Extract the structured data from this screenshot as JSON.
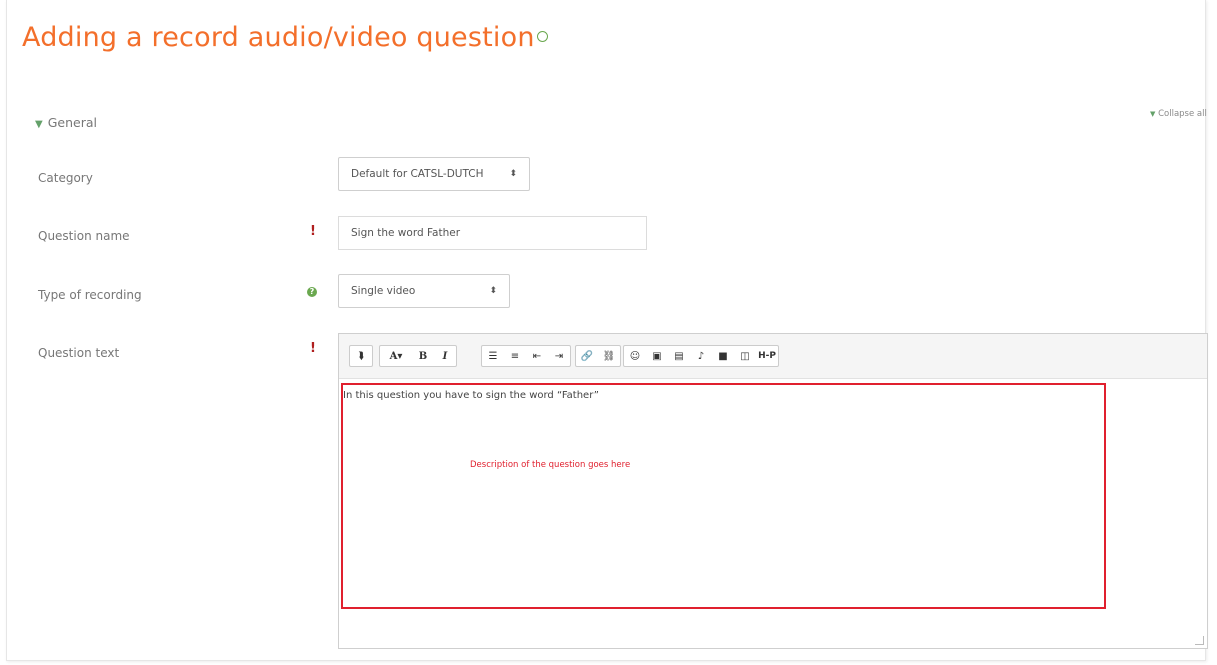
{
  "page": {
    "title": "Adding a record audio/video question",
    "collapse_all": "Collapse all"
  },
  "section": {
    "general_label": "General"
  },
  "form": {
    "category": {
      "label": "Category",
      "value": "Default for CATSL-DUTCH"
    },
    "question_name": {
      "label": "Question name",
      "value": "Sign the word Father",
      "required": true
    },
    "type_of_recording": {
      "label": "Type of recording",
      "value": "Single video"
    },
    "question_text": {
      "label": "Question text",
      "content": "In this question you have to sign the word “Father”",
      "required": true
    }
  },
  "editor": {
    "toolbar": [
      [
        "show-more-icon"
      ],
      [
        "font-size-icon",
        "bold-icon",
        "italic-icon"
      ],
      [
        "bullet-list-icon",
        "numbered-list-icon",
        "outdent-icon",
        "indent-icon"
      ],
      [
        "link-icon",
        "unlink-icon"
      ],
      [
        "emoticon-icon",
        "image-icon",
        "media-icon",
        "record-audio-icon",
        "record-video-icon",
        "manage-files-icon",
        "h5p-icon"
      ]
    ]
  },
  "annotation": {
    "text": "Description of the question goes here"
  },
  "colors": {
    "title": "#f36f2b",
    "required": "#b01f1f",
    "help": "#6aa84f",
    "annotation": "#e0202e"
  }
}
